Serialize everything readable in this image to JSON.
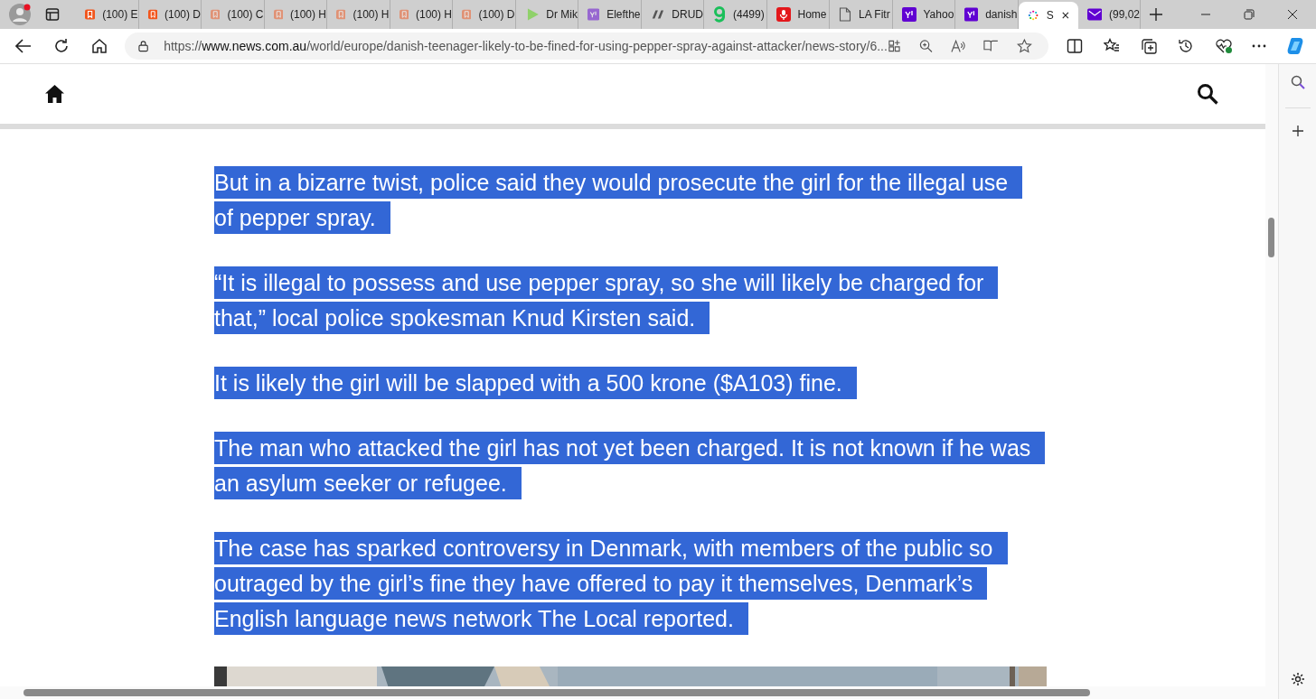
{
  "tabs": [
    {
      "label": "(100) E",
      "kind": "bookmark",
      "faded": false,
      "selected": false
    },
    {
      "label": "(100) D",
      "kind": "bookmark",
      "faded": false,
      "selected": false
    },
    {
      "label": "(100) C",
      "kind": "bookmark",
      "faded": true,
      "selected": false
    },
    {
      "label": "(100) H",
      "kind": "bookmark",
      "faded": true,
      "selected": false
    },
    {
      "label": "(100) H",
      "kind": "bookmark",
      "faded": true,
      "selected": false
    },
    {
      "label": "(100) H",
      "kind": "bookmark",
      "faded": true,
      "selected": false
    },
    {
      "label": "(100) D",
      "kind": "bookmark",
      "faded": true,
      "selected": false
    },
    {
      "label": "Dr Mik",
      "kind": "play",
      "faded": false,
      "selected": false
    },
    {
      "label": "Elefthe",
      "kind": "yahoo",
      "faded": true,
      "selected": false
    },
    {
      "label": "DRUD",
      "kind": "slashes",
      "faded": false,
      "selected": false
    },
    {
      "label": "(4499)",
      "kind": "g",
      "faded": false,
      "selected": false
    },
    {
      "label": "Home",
      "kind": "mic",
      "faded": false,
      "selected": false
    },
    {
      "label": "LA Fitr",
      "kind": "page",
      "faded": false,
      "selected": false
    },
    {
      "label": "Yahoo",
      "kind": "yahoo",
      "faded": false,
      "selected": false
    },
    {
      "label": "danish",
      "kind": "yahoo",
      "faded": false,
      "selected": false
    },
    {
      "label": "S",
      "kind": "loading",
      "faded": false,
      "selected": true
    },
    {
      "label": "(99,02",
      "kind": "mail",
      "faded": false,
      "selected": false
    }
  ],
  "address_bar": {
    "scheme": "https://",
    "host": "www.news.com.au",
    "path": "/world/europe/danish-teenager-likely-to-be-fined-for-using-pepper-spray-against-attacker/news-story/6..."
  },
  "article": {
    "paragraphs": [
      "But in a bizarre twist, police said they would prosecute the girl for the illegal use of pepper spray.",
      "“It is illegal to possess and use pepper spray, so she will likely be charged for that,” local police spokesman Knud Kirsten said.",
      "It is likely the girl will be slapped with a 500 krone ($A103) fine.",
      "The man who attacked the girl has not yet been charged. It is not known if he was an asylum seeker or refugee.",
      "The case has sparked controversy in Denmark, with members of the public so outraged by the girl’s fine they have offered to pay it themselves, Denmark’s English language news network The Local reported."
    ],
    "selected": true
  }
}
